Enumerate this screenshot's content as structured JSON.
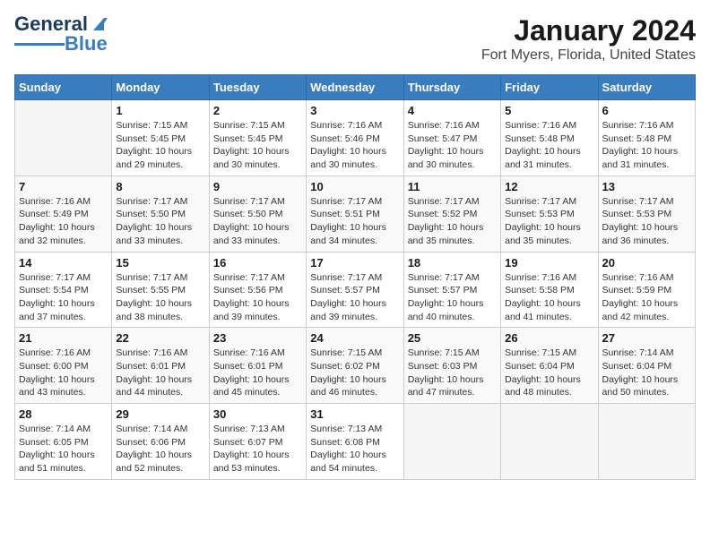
{
  "app": {
    "name": "GeneralBlue",
    "title": "January 2024",
    "subtitle": "Fort Myers, Florida, United States"
  },
  "calendar": {
    "headers": [
      "Sunday",
      "Monday",
      "Tuesday",
      "Wednesday",
      "Thursday",
      "Friday",
      "Saturday"
    ],
    "weeks": [
      [
        {
          "num": "",
          "info": ""
        },
        {
          "num": "1",
          "info": "Sunrise: 7:15 AM\nSunset: 5:45 PM\nDaylight: 10 hours\nand 29 minutes."
        },
        {
          "num": "2",
          "info": "Sunrise: 7:15 AM\nSunset: 5:45 PM\nDaylight: 10 hours\nand 30 minutes."
        },
        {
          "num": "3",
          "info": "Sunrise: 7:16 AM\nSunset: 5:46 PM\nDaylight: 10 hours\nand 30 minutes."
        },
        {
          "num": "4",
          "info": "Sunrise: 7:16 AM\nSunset: 5:47 PM\nDaylight: 10 hours\nand 30 minutes."
        },
        {
          "num": "5",
          "info": "Sunrise: 7:16 AM\nSunset: 5:48 PM\nDaylight: 10 hours\nand 31 minutes."
        },
        {
          "num": "6",
          "info": "Sunrise: 7:16 AM\nSunset: 5:48 PM\nDaylight: 10 hours\nand 31 minutes."
        }
      ],
      [
        {
          "num": "7",
          "info": "Sunrise: 7:16 AM\nSunset: 5:49 PM\nDaylight: 10 hours\nand 32 minutes."
        },
        {
          "num": "8",
          "info": "Sunrise: 7:17 AM\nSunset: 5:50 PM\nDaylight: 10 hours\nand 33 minutes."
        },
        {
          "num": "9",
          "info": "Sunrise: 7:17 AM\nSunset: 5:50 PM\nDaylight: 10 hours\nand 33 minutes."
        },
        {
          "num": "10",
          "info": "Sunrise: 7:17 AM\nSunset: 5:51 PM\nDaylight: 10 hours\nand 34 minutes."
        },
        {
          "num": "11",
          "info": "Sunrise: 7:17 AM\nSunset: 5:52 PM\nDaylight: 10 hours\nand 35 minutes."
        },
        {
          "num": "12",
          "info": "Sunrise: 7:17 AM\nSunset: 5:53 PM\nDaylight: 10 hours\nand 35 minutes."
        },
        {
          "num": "13",
          "info": "Sunrise: 7:17 AM\nSunset: 5:53 PM\nDaylight: 10 hours\nand 36 minutes."
        }
      ],
      [
        {
          "num": "14",
          "info": "Sunrise: 7:17 AM\nSunset: 5:54 PM\nDaylight: 10 hours\nand 37 minutes."
        },
        {
          "num": "15",
          "info": "Sunrise: 7:17 AM\nSunset: 5:55 PM\nDaylight: 10 hours\nand 38 minutes."
        },
        {
          "num": "16",
          "info": "Sunrise: 7:17 AM\nSunset: 5:56 PM\nDaylight: 10 hours\nand 39 minutes."
        },
        {
          "num": "17",
          "info": "Sunrise: 7:17 AM\nSunset: 5:57 PM\nDaylight: 10 hours\nand 39 minutes."
        },
        {
          "num": "18",
          "info": "Sunrise: 7:17 AM\nSunset: 5:57 PM\nDaylight: 10 hours\nand 40 minutes."
        },
        {
          "num": "19",
          "info": "Sunrise: 7:16 AM\nSunset: 5:58 PM\nDaylight: 10 hours\nand 41 minutes."
        },
        {
          "num": "20",
          "info": "Sunrise: 7:16 AM\nSunset: 5:59 PM\nDaylight: 10 hours\nand 42 minutes."
        }
      ],
      [
        {
          "num": "21",
          "info": "Sunrise: 7:16 AM\nSunset: 6:00 PM\nDaylight: 10 hours\nand 43 minutes."
        },
        {
          "num": "22",
          "info": "Sunrise: 7:16 AM\nSunset: 6:01 PM\nDaylight: 10 hours\nand 44 minutes."
        },
        {
          "num": "23",
          "info": "Sunrise: 7:16 AM\nSunset: 6:01 PM\nDaylight: 10 hours\nand 45 minutes."
        },
        {
          "num": "24",
          "info": "Sunrise: 7:15 AM\nSunset: 6:02 PM\nDaylight: 10 hours\nand 46 minutes."
        },
        {
          "num": "25",
          "info": "Sunrise: 7:15 AM\nSunset: 6:03 PM\nDaylight: 10 hours\nand 47 minutes."
        },
        {
          "num": "26",
          "info": "Sunrise: 7:15 AM\nSunset: 6:04 PM\nDaylight: 10 hours\nand 48 minutes."
        },
        {
          "num": "27",
          "info": "Sunrise: 7:14 AM\nSunset: 6:04 PM\nDaylight: 10 hours\nand 50 minutes."
        }
      ],
      [
        {
          "num": "28",
          "info": "Sunrise: 7:14 AM\nSunset: 6:05 PM\nDaylight: 10 hours\nand 51 minutes."
        },
        {
          "num": "29",
          "info": "Sunrise: 7:14 AM\nSunset: 6:06 PM\nDaylight: 10 hours\nand 52 minutes."
        },
        {
          "num": "30",
          "info": "Sunrise: 7:13 AM\nSunset: 6:07 PM\nDaylight: 10 hours\nand 53 minutes."
        },
        {
          "num": "31",
          "info": "Sunrise: 7:13 AM\nSunset: 6:08 PM\nDaylight: 10 hours\nand 54 minutes."
        },
        {
          "num": "",
          "info": ""
        },
        {
          "num": "",
          "info": ""
        },
        {
          "num": "",
          "info": ""
        }
      ]
    ]
  }
}
